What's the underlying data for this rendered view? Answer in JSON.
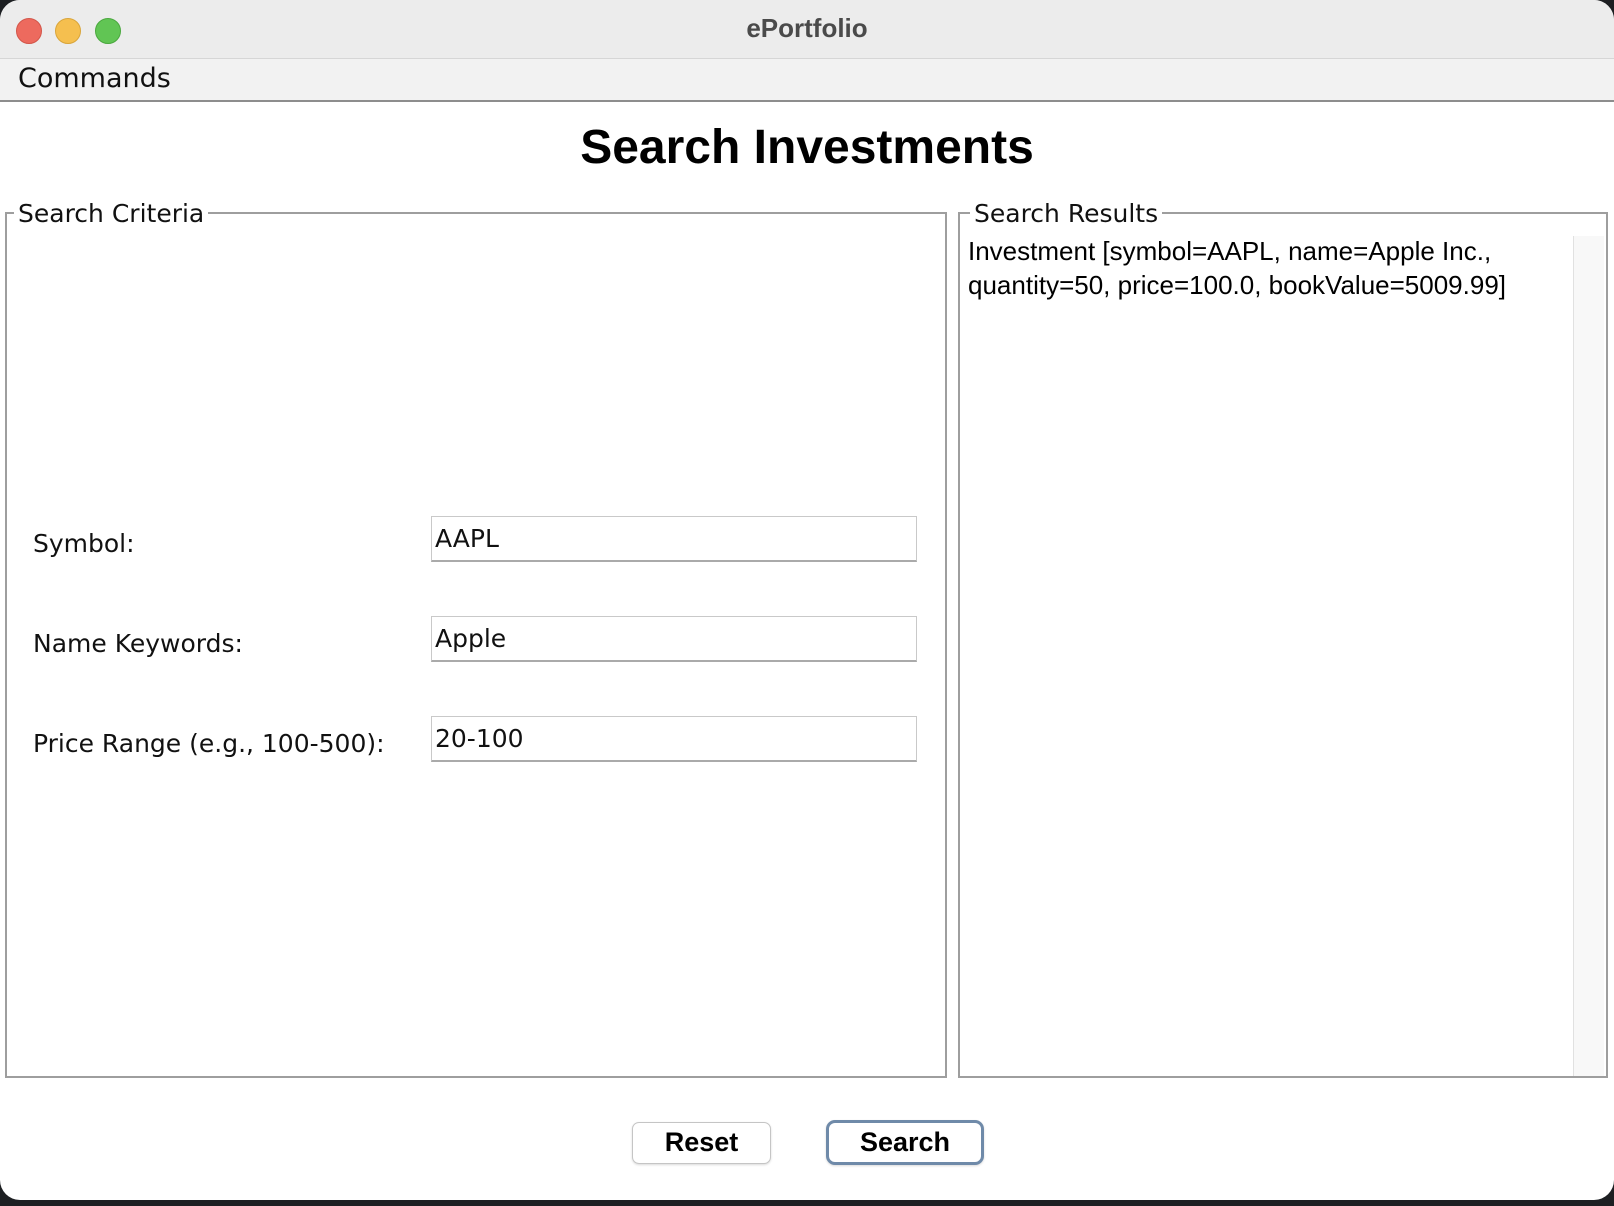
{
  "window": {
    "title": "ePortfolio"
  },
  "menubar": {
    "items": [
      {
        "label": "Commands"
      }
    ]
  },
  "page": {
    "title": "Search Investments"
  },
  "criteria": {
    "legend": "Search Criteria",
    "fields": [
      {
        "label": "Symbol:",
        "value": "AAPL"
      },
      {
        "label": "Name Keywords:",
        "value": "Apple"
      },
      {
        "label": "Price Range (e.g., 100-500):",
        "value": "20-100"
      }
    ]
  },
  "results": {
    "legend": "Search Results",
    "text": "Investment [symbol=AAPL, name=Apple Inc., quantity=50, price=100.0, bookValue=5009.99]"
  },
  "buttons": {
    "reset_label": "Reset",
    "search_label": "Search"
  },
  "colors": {
    "close": "#ed6a5e",
    "minimize": "#f5bf4f",
    "zoom": "#61c554",
    "default_button_border": "#6f8aa9"
  }
}
